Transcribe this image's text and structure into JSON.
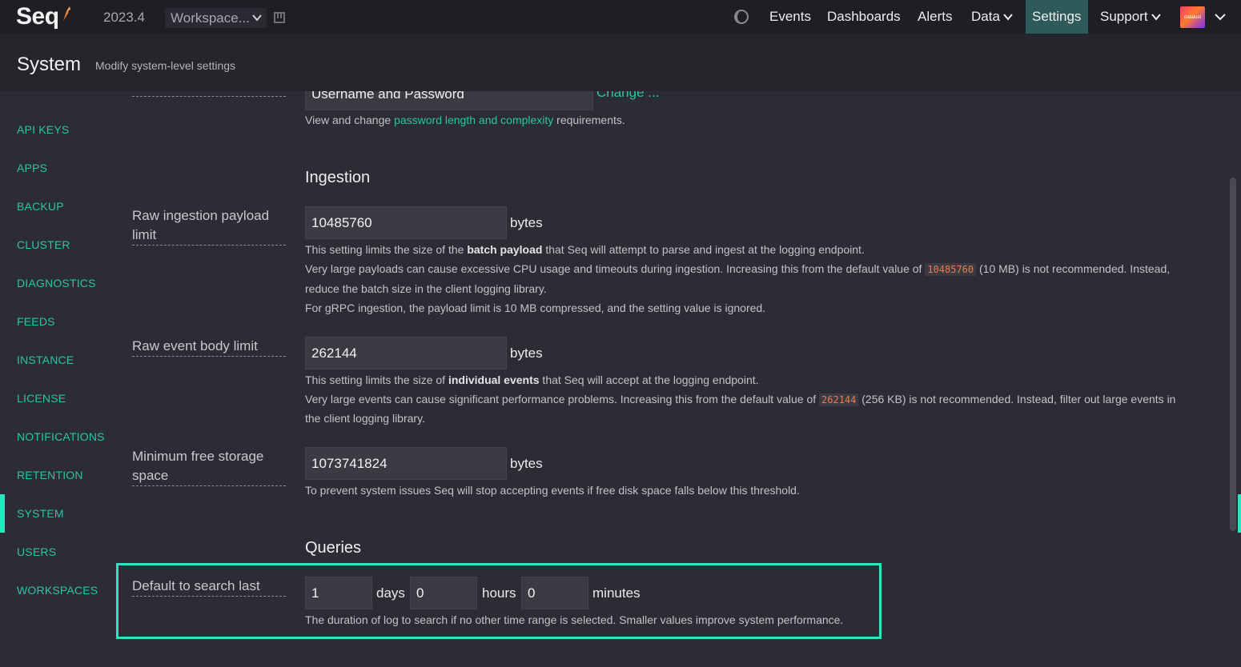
{
  "app": {
    "logo_text": "Seq",
    "version": "2023.4",
    "workspace_label": "Workspace...",
    "avatar_text": "datalust"
  },
  "nav": {
    "items": [
      {
        "label": "Events"
      },
      {
        "label": "Dashboards"
      },
      {
        "label": "Alerts"
      },
      {
        "label": "Data"
      },
      {
        "label": "Settings"
      },
      {
        "label": "Support"
      }
    ],
    "active": "Settings"
  },
  "header": {
    "title": "System",
    "subtitle": "Modify system-level settings"
  },
  "sidebar": {
    "items": [
      {
        "label": "API KEYS"
      },
      {
        "label": "APPS"
      },
      {
        "label": "BACKUP"
      },
      {
        "label": "CLUSTER"
      },
      {
        "label": "DIAGNOSTICS"
      },
      {
        "label": "FEEDS"
      },
      {
        "label": "INSTANCE"
      },
      {
        "label": "LICENSE"
      },
      {
        "label": "NOTIFICATIONS"
      },
      {
        "label": "RETENTION"
      },
      {
        "label": "SYSTEM"
      },
      {
        "label": "USERS"
      },
      {
        "label": "WORKSPACES"
      }
    ],
    "active": "SYSTEM"
  },
  "auth": {
    "value": "Username and Password",
    "change_link": "Change ...",
    "help_pre": "View and change ",
    "help_link": "password length and complexity",
    "help_post": " requirements."
  },
  "ingestion": {
    "heading": "Ingestion",
    "payload": {
      "label": "Raw ingestion payload limit",
      "value": "10485760",
      "unit": "bytes",
      "help1_pre": "This setting limits the size of the ",
      "help1_bold": "batch payload",
      "help1_post": " that Seq will attempt to parse and ingest at the logging endpoint.",
      "help2_pre": "Very large payloads can cause excessive CPU usage and timeouts during ingestion. Increasing this from the default value of ",
      "help2_code": "10485760",
      "help2_post": " (10 MB) is not recommended. Instead,",
      "help3": "reduce the batch size in the client logging library.",
      "help4": "For gRPC ingestion, the payload limit is 10 MB compressed, and the setting value is ignored."
    },
    "event_body": {
      "label": "Raw event body limit",
      "value": "262144",
      "unit": "bytes",
      "help1_pre": "This setting limits the size of ",
      "help1_bold": "individual events",
      "help1_post": " that Seq will accept at the logging endpoint.",
      "help2_pre": "Very large events can cause significant performance problems. Increasing this from the default value of ",
      "help2_code": "262144",
      "help2_post": " (256 KB) is not recommended. Instead, filter out large events in",
      "help3": "the client logging library."
    },
    "free_storage": {
      "label": "Minimum free storage space",
      "value": "1073741824",
      "unit": "bytes",
      "help": "To prevent system issues Seq will stop accepting events if free disk space falls below this threshold."
    }
  },
  "queries": {
    "heading": "Queries",
    "default_search": {
      "label": "Default to search last",
      "days_value": "1",
      "days_unit": "days",
      "hours_value": "0",
      "hours_unit": "hours",
      "minutes_value": "0",
      "minutes_unit": "minutes",
      "help": "The duration of log to search if no other time range is selected. Smaller values improve system performance."
    }
  },
  "colors": {
    "accent": "#2ee3c0",
    "link": "#26c6a6",
    "active_nav": "#2f5a5a",
    "code": "#f07a4a"
  }
}
